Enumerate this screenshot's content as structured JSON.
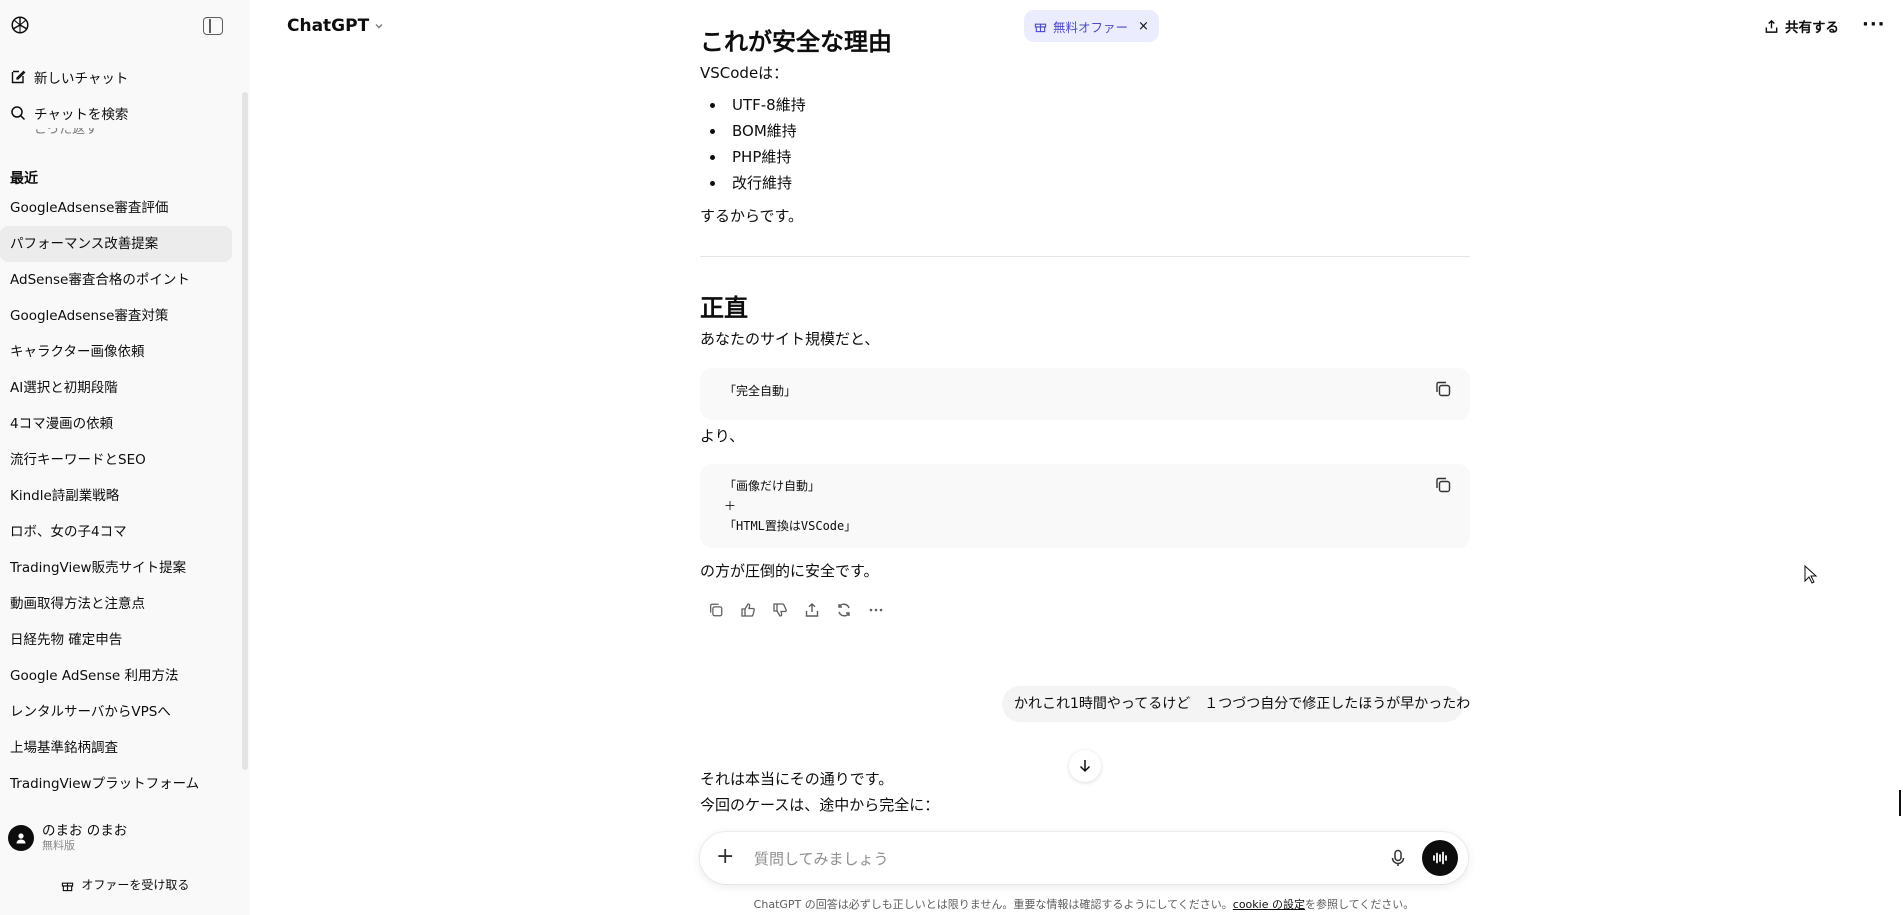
{
  "sidebar": {
    "new_chat": "新しいチャット",
    "search_chats": "チャットを検索",
    "cut_off_item": "こった返す",
    "section_recent": "最近",
    "chats": [
      {
        "label": "GoogleAdsense審査評価",
        "active": false
      },
      {
        "label": "パフォーマンス改善提案",
        "active": true
      },
      {
        "label": "AdSense審査合格のポイント",
        "active": false
      },
      {
        "label": "GoogleAdsense審査対策",
        "active": false
      },
      {
        "label": "キャラクター画像依頼",
        "active": false
      },
      {
        "label": "AI選択と初期段階",
        "active": false
      },
      {
        "label": "4コマ漫画の依頼",
        "active": false
      },
      {
        "label": "流行キーワードとSEO",
        "active": false
      },
      {
        "label": "Kindle詩副業戦略",
        "active": false
      },
      {
        "label": "ロボ、女の子4コマ",
        "active": false
      },
      {
        "label": "TradingView販売サイト提案",
        "active": false
      },
      {
        "label": "動画取得方法と注意点",
        "active": false
      },
      {
        "label": "日経先物 確定申告",
        "active": false
      },
      {
        "label": "Google AdSense 利用方法",
        "active": false
      },
      {
        "label": "レンタルサーバからVPSへ",
        "active": false
      },
      {
        "label": "上場基準銘柄調査",
        "active": false
      },
      {
        "label": "TradingViewプラットフォーム",
        "active": false
      }
    ],
    "user": {
      "name": "のまお のまお",
      "plan": "無料版"
    },
    "claim_offer": "オファーを受け取る"
  },
  "header": {
    "model": "ChatGPT",
    "offer_pill": "無料オファー",
    "offer_close": "×",
    "share": "共有する",
    "more": "···"
  },
  "message": {
    "heading1": "これが安全な理由",
    "vscode_intro": "VSCodeは：",
    "bullets": [
      "UTF-8維持",
      "BOM維持",
      "PHP維持",
      "改行維持"
    ],
    "because": "するからです。",
    "heading2": "正直",
    "site_scale": "あなたのサイト規模だと、",
    "code1": [
      "「完全自動」"
    ],
    "rather": "より、",
    "code2": [
      "「画像だけ自動」",
      "＋",
      "「HTML置換はVSCode」"
    ],
    "safer": "の方が圧倒的に安全です。"
  },
  "user_message": "かれこれ1時間やってるけど　１つづつ自分で修正したほうが早かったわ",
  "reply": {
    "line1": "それは本当にその通りです。",
    "line2": "今回のケースは、途中から完全に："
  },
  "composer": {
    "placeholder": "質問してみましょう",
    "disclaimer_prefix": "ChatGPT の回答は必ずしも正しいとは限りません。重要な情報は確認するようにしてください。",
    "disclaimer_link": "cookie の設定",
    "disclaimer_suffix": "を参照してください。"
  }
}
